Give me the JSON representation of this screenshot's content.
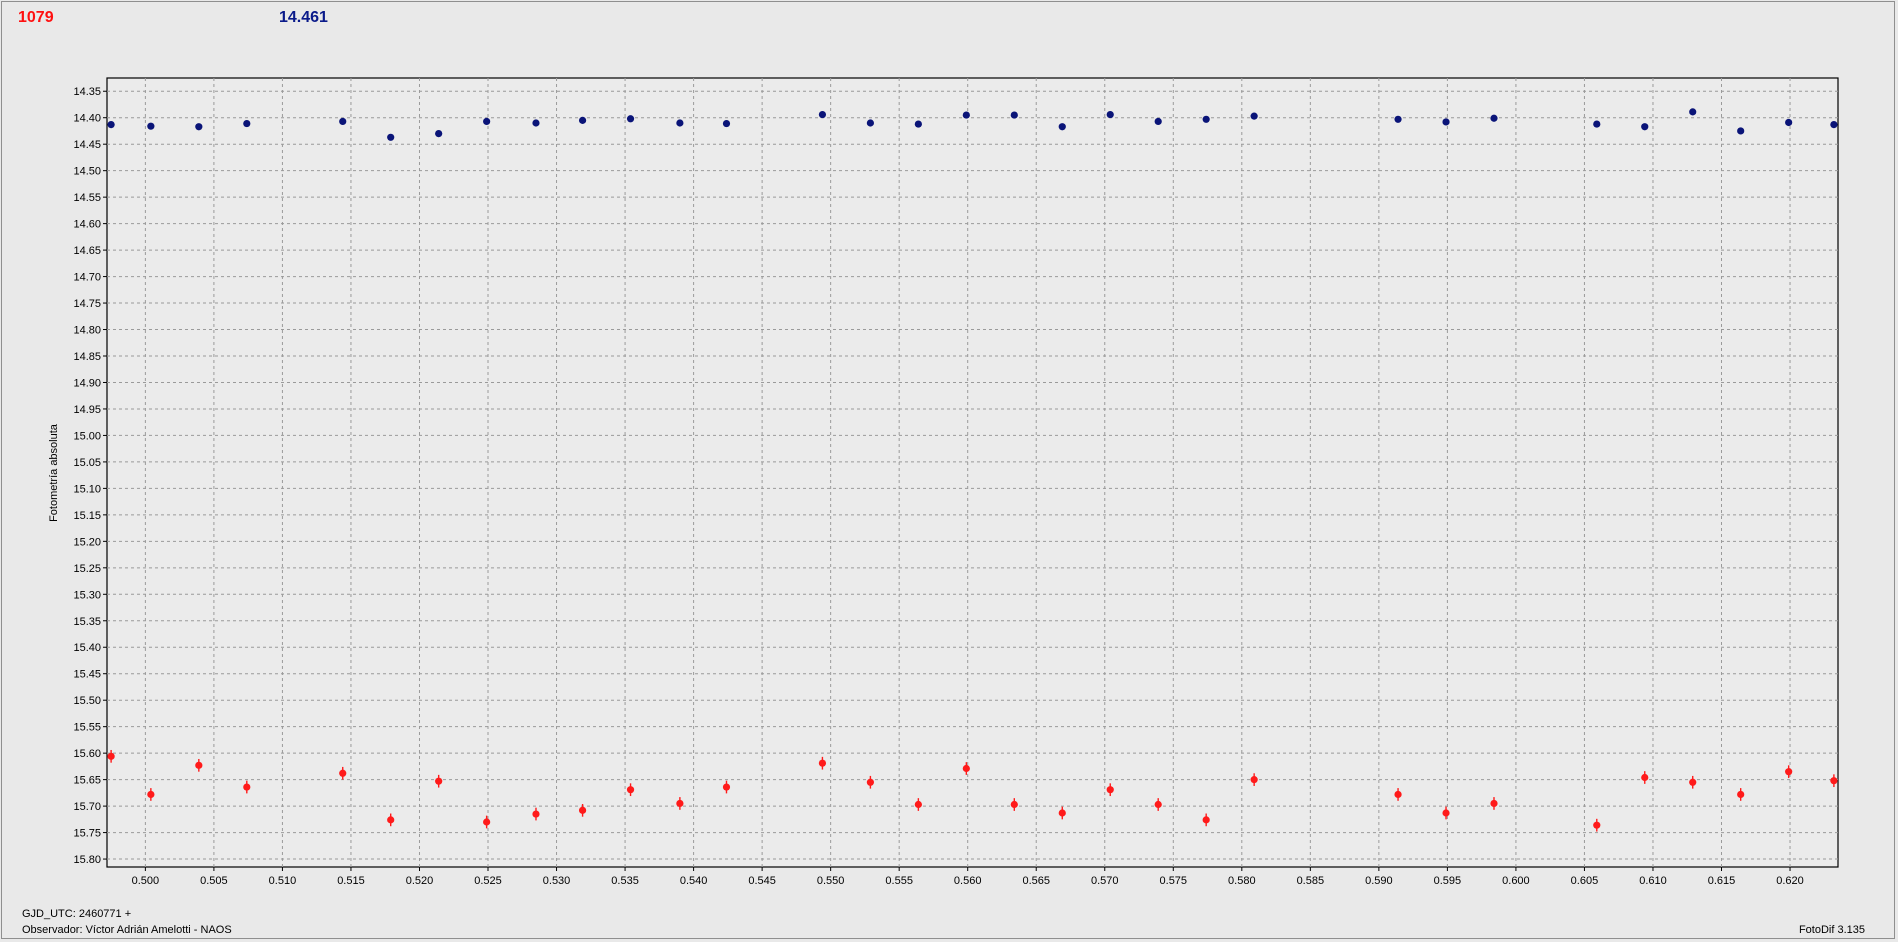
{
  "header": {
    "left_value": "1079",
    "right_value": "14.461"
  },
  "footer": {
    "gjd": "GJD_UTC: 2460771 +",
    "observer": "Observador: Víctor Adrián Amelotti - NAOS",
    "version": "FotoDif 3.135"
  },
  "colors": {
    "series_red": "#ff1a1a",
    "series_blue": "#0a1478",
    "grid": "#9a9a9a",
    "plot_bg": "#ebebeb"
  },
  "chart_data": {
    "type": "scatter",
    "title": "",
    "xlabel": "",
    "ylabel": "Fotometría absoluta",
    "xlim": [
      0.4972,
      0.6235
    ],
    "ylim": [
      14.325,
      15.815
    ],
    "y_inverted": true,
    "grid": true,
    "x_ticks": [
      "0.500",
      "0.505",
      "0.510",
      "0.515",
      "0.520",
      "0.525",
      "0.530",
      "0.535",
      "0.540",
      "0.545",
      "0.550",
      "0.555",
      "0.560",
      "0.565",
      "0.570",
      "0.575",
      "0.580",
      "0.585",
      "0.590",
      "0.595",
      "0.600",
      "0.605",
      "0.610",
      "0.615",
      "0.620"
    ],
    "y_ticks": [
      "14.35",
      "14.40",
      "14.45",
      "14.50",
      "14.55",
      "14.60",
      "14.65",
      "14.70",
      "14.75",
      "14.80",
      "14.85",
      "14.90",
      "14.95",
      "15.00",
      "15.05",
      "15.10",
      "15.15",
      "15.20",
      "15.25",
      "15.30",
      "15.35",
      "15.40",
      "15.45",
      "15.50",
      "15.55",
      "15.60",
      "15.65",
      "15.70",
      "15.75",
      "15.80"
    ],
    "series": [
      {
        "color": "#0a1478",
        "x": [
          0.4975,
          0.5004,
          0.5039,
          0.5074,
          0.5144,
          0.5179,
          0.5214,
          0.5249,
          0.5285,
          0.5319,
          0.5354,
          0.539,
          0.5424,
          0.5494,
          0.5529,
          0.5564,
          0.5599,
          0.5634,
          0.5669,
          0.5704,
          0.5739,
          0.5774,
          0.5809,
          0.5914,
          0.5949,
          0.5984,
          0.6059,
          0.6094,
          0.6129,
          0.6164,
          0.6199,
          0.6232
        ],
        "y": [
          14.413,
          14.416,
          14.417,
          14.411,
          14.407,
          14.437,
          14.43,
          14.407,
          14.41,
          14.405,
          14.402,
          14.41,
          14.411,
          14.394,
          14.41,
          14.412,
          14.395,
          14.395,
          14.417,
          14.394,
          14.407,
          14.403,
          14.397,
          14.403,
          14.408,
          14.401,
          14.412,
          14.417,
          14.389,
          14.425,
          14.409,
          14.413
        ],
        "err": [
          0.006,
          0.006,
          0.006,
          0.006,
          0.006,
          0.006,
          0.006,
          0.006,
          0.006,
          0.006,
          0.006,
          0.006,
          0.006,
          0.006,
          0.006,
          0.006,
          0.006,
          0.006,
          0.006,
          0.006,
          0.006,
          0.006,
          0.006,
          0.006,
          0.006,
          0.006,
          0.006,
          0.006,
          0.006,
          0.006,
          0.006,
          0.006
        ]
      },
      {
        "color": "#ff1a1a",
        "x": [
          0.4975,
          0.5004,
          0.5039,
          0.5074,
          0.5144,
          0.5179,
          0.5214,
          0.5249,
          0.5285,
          0.5319,
          0.5354,
          0.539,
          0.5424,
          0.5494,
          0.5529,
          0.5564,
          0.5599,
          0.5634,
          0.5669,
          0.5704,
          0.5739,
          0.5774,
          0.5809,
          0.5914,
          0.5949,
          0.5984,
          0.6059,
          0.6094,
          0.6129,
          0.6164,
          0.6199,
          0.6232
        ],
        "y": [
          15.606,
          15.678,
          15.623,
          15.664,
          15.638,
          15.726,
          15.653,
          15.73,
          15.715,
          15.708,
          15.669,
          15.695,
          15.664,
          15.619,
          15.655,
          15.697,
          15.629,
          15.697,
          15.713,
          15.669,
          15.697,
          15.726,
          15.65,
          15.678,
          15.713,
          15.695,
          15.736,
          15.646,
          15.655,
          15.678,
          15.635,
          15.652
        ],
        "err": [
          0.012,
          0.012,
          0.012,
          0.012,
          0.012,
          0.012,
          0.012,
          0.012,
          0.012,
          0.012,
          0.012,
          0.012,
          0.012,
          0.012,
          0.012,
          0.012,
          0.012,
          0.012,
          0.012,
          0.012,
          0.012,
          0.012,
          0.012,
          0.012,
          0.012,
          0.012,
          0.012,
          0.012,
          0.012,
          0.012,
          0.012,
          0.012
        ]
      }
    ]
  }
}
